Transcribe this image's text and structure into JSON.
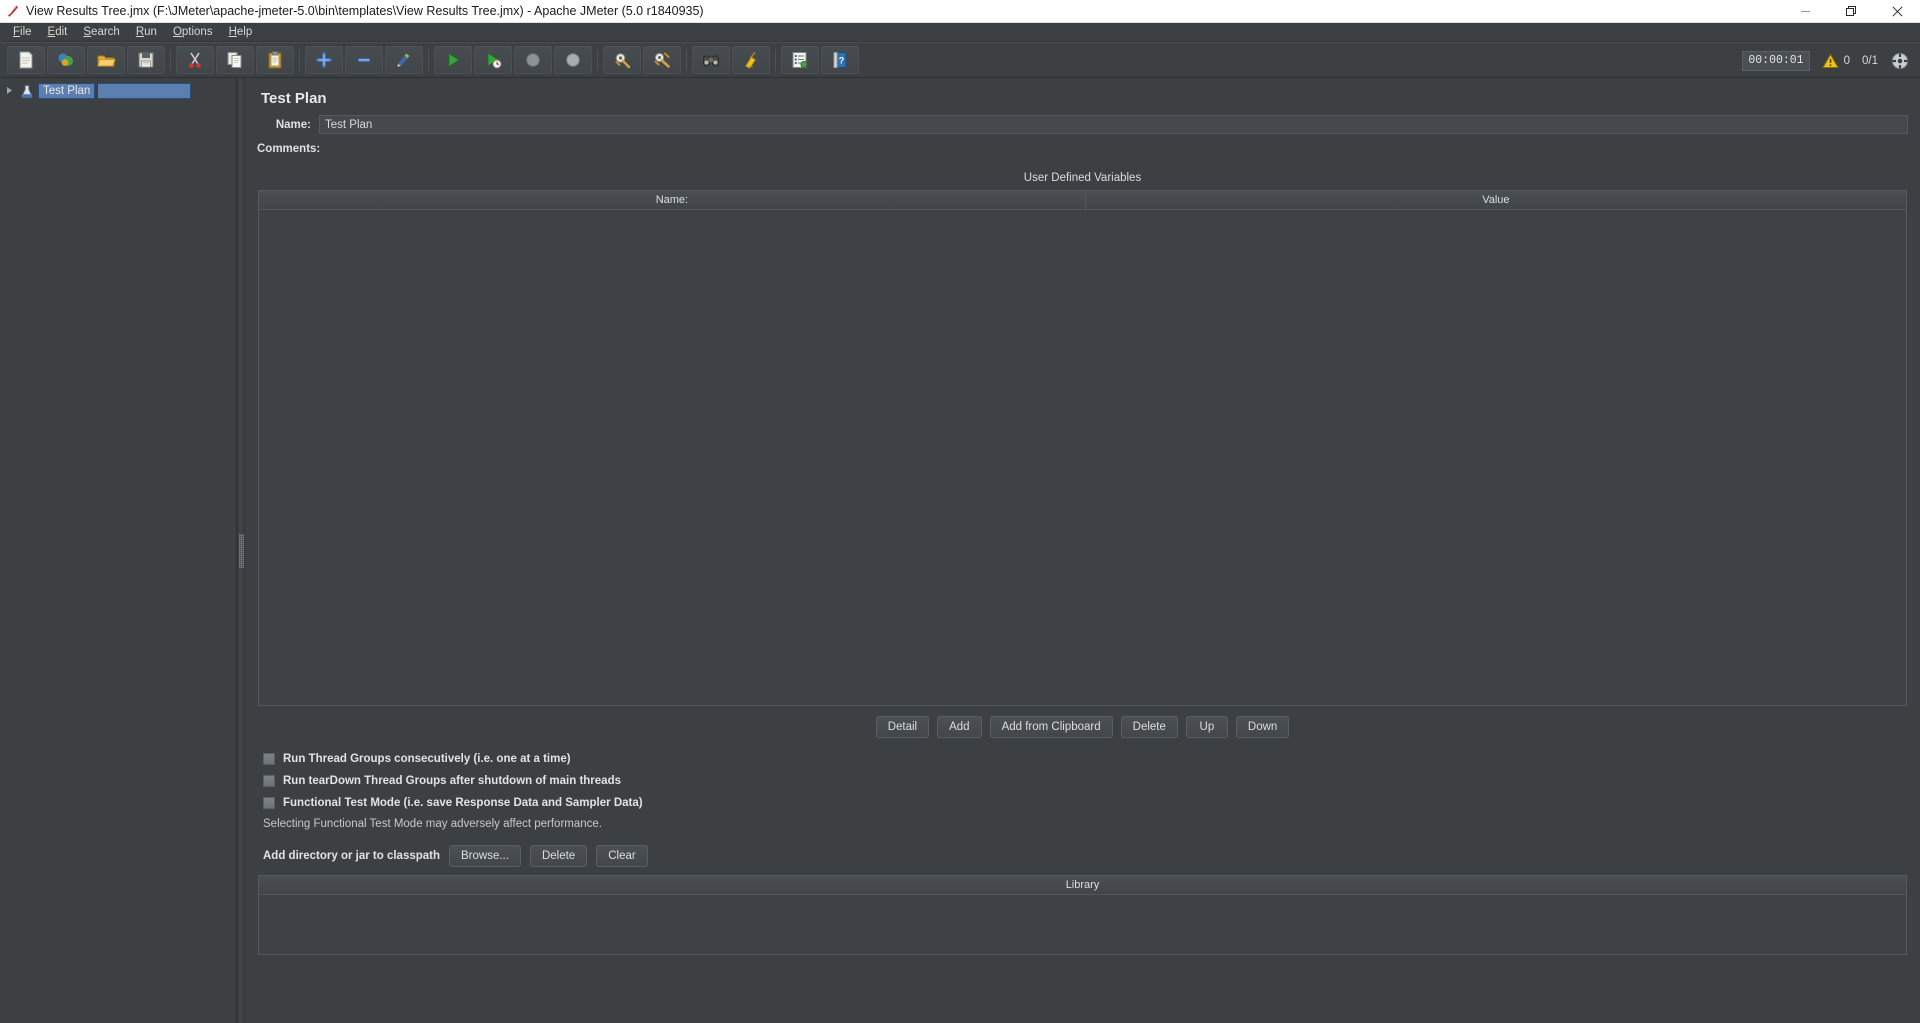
{
  "window": {
    "title": "View Results Tree.jmx (F:\\JMeter\\apache-jmeter-5.0\\bin\\templates\\View Results Tree.jmx) - Apache JMeter (5.0 r1840935)",
    "app_icon": "jmeter-feather-icon",
    "minimize_label": "Minimize",
    "restore_label": "Restore",
    "close_label": "Close"
  },
  "menubar": {
    "items": [
      {
        "label": "File",
        "mnemonic": "F"
      },
      {
        "label": "Edit",
        "mnemonic": "E"
      },
      {
        "label": "Search",
        "mnemonic": "S"
      },
      {
        "label": "Run",
        "mnemonic": "R"
      },
      {
        "label": "Options",
        "mnemonic": "O"
      },
      {
        "label": "Help",
        "mnemonic": "H"
      }
    ]
  },
  "toolbar": {
    "buttons": [
      {
        "name": "new-test-plan",
        "icon": "new-document-icon",
        "tooltip": "New"
      },
      {
        "name": "templates",
        "icon": "templates-icon",
        "tooltip": "Templates"
      },
      {
        "name": "open",
        "icon": "open-folder-icon",
        "tooltip": "Open"
      },
      {
        "name": "save-test-plan",
        "icon": "save-floppy-icon",
        "tooltip": "Save Test Plan"
      },
      {
        "name": "cut",
        "icon": "scissors-icon",
        "tooltip": "Cut"
      },
      {
        "name": "copy",
        "icon": "copy-pages-icon",
        "tooltip": "Copy"
      },
      {
        "name": "paste",
        "icon": "clipboard-icon",
        "tooltip": "Paste"
      },
      {
        "name": "expand-all",
        "icon": "plus-icon",
        "tooltip": "Expand All"
      },
      {
        "name": "collapse-all",
        "icon": "minus-icon",
        "tooltip": "Collapse All"
      },
      {
        "name": "toggle",
        "icon": "toggle-pencil-icon",
        "tooltip": "Toggle"
      },
      {
        "name": "start",
        "icon": "play-green-icon",
        "tooltip": "Start"
      },
      {
        "name": "start-no-timers",
        "icon": "play-no-timers-icon",
        "tooltip": "Start no pauses"
      },
      {
        "name": "stop",
        "icon": "stop-circle-icon",
        "tooltip": "Stop"
      },
      {
        "name": "shutdown",
        "icon": "shutdown-circle-icon",
        "tooltip": "Shutdown"
      },
      {
        "name": "clear",
        "icon": "clear-gear-icon",
        "tooltip": "Clear"
      },
      {
        "name": "clear-all",
        "icon": "clear-all-gear-icon",
        "tooltip": "Clear All"
      },
      {
        "name": "search",
        "icon": "binoculars-icon",
        "tooltip": "Search"
      },
      {
        "name": "search-reset",
        "icon": "broom-icon",
        "tooltip": "Reset Search"
      },
      {
        "name": "function-helper",
        "icon": "log-list-icon",
        "tooltip": "Function Helper Dialog"
      },
      {
        "name": "help",
        "icon": "help-book-icon",
        "tooltip": "Help"
      }
    ],
    "separators_after": [
      3,
      6,
      9,
      13,
      15,
      17
    ],
    "elapsed_time": "00:00:01",
    "warning_icon": "warning-triangle-icon",
    "warning_count": "0",
    "thread_counter": "0/1",
    "remote_icon": "remote-engine-icon"
  },
  "tree": {
    "nodes": [
      {
        "label": "Test Plan",
        "icon": "test-plan-icon",
        "expander": "collapsed-triangle-icon",
        "selected": true
      }
    ]
  },
  "main": {
    "panel_title": "Test Plan",
    "name_label": "Name:",
    "name_value": "Test Plan",
    "name_placeholder": "Test Plan",
    "comments_label": "Comments:",
    "comments_value": "",
    "comments_placeholder": "",
    "udv": {
      "title": "User Defined Variables",
      "columns": [
        "Name:",
        "Value"
      ],
      "rows": [],
      "buttons": [
        {
          "name": "detail-button",
          "label": "Detail"
        },
        {
          "name": "add-button",
          "label": "Add"
        },
        {
          "name": "add-from-clipboard-button",
          "label": "Add from Clipboard"
        },
        {
          "name": "delete-button",
          "label": "Delete"
        },
        {
          "name": "up-button",
          "label": "Up"
        },
        {
          "name": "down-button",
          "label": "Down"
        }
      ]
    },
    "checkboxes": [
      {
        "name": "run-thread-groups-consecutively",
        "label": "Run Thread Groups consecutively (i.e. one at a time)",
        "checked": false
      },
      {
        "name": "run-teardown-thread-groups",
        "label": "Run tearDown Thread Groups after shutdown of main threads",
        "checked": false
      },
      {
        "name": "functional-test-mode",
        "label": "Functional Test Mode (i.e. save Response Data and Sampler Data)",
        "checked": false
      }
    ],
    "functional_note": "Selecting Functional Test Mode may adversely affect performance.",
    "classpath": {
      "label": "Add directory or jar to classpath",
      "buttons": [
        {
          "name": "browse-button",
          "label": "Browse..."
        },
        {
          "name": "classpath-delete-button",
          "label": "Delete"
        },
        {
          "name": "classpath-clear-button",
          "label": "Clear"
        }
      ],
      "library_column": "Library",
      "library_rows": []
    }
  },
  "colors": {
    "window_bg": "#3c4043",
    "selection_blue": "#5a7fb0",
    "titlebar_bg": "#ffffff",
    "accent_green": "#3faa3f",
    "warning_yellow": "#e8c01f"
  }
}
